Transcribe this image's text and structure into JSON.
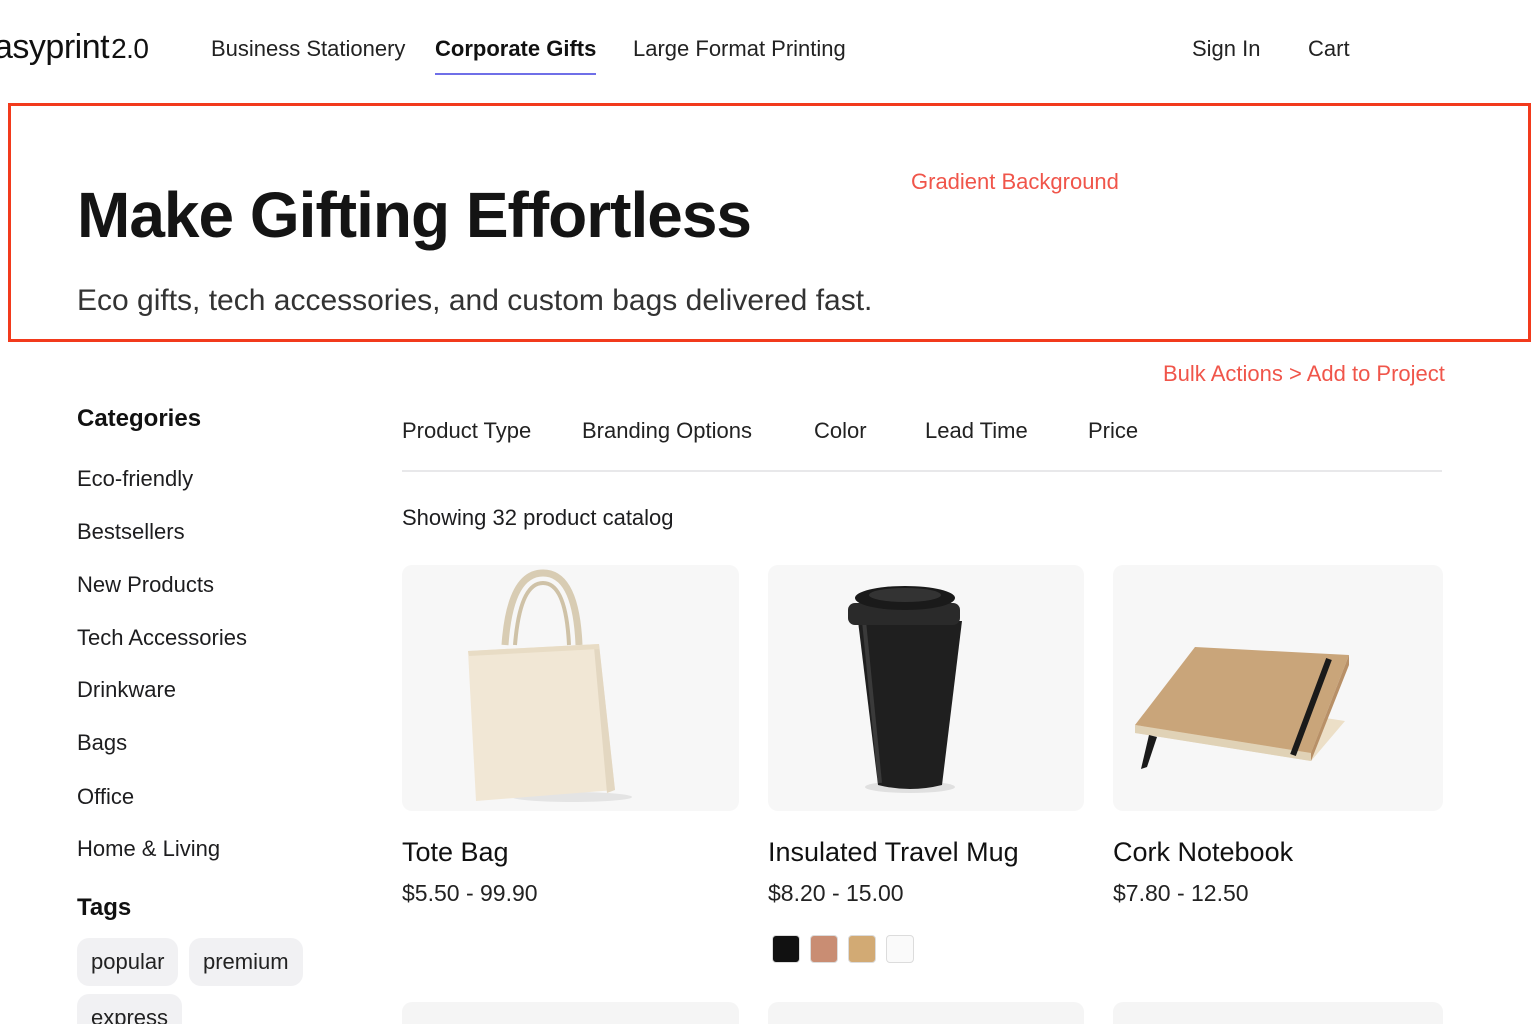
{
  "nav": {
    "logo_text": "asyprint",
    "logo_version": "2.0",
    "links": [
      "Business Stationery",
      "Corporate Gifts",
      "Large Format Printing"
    ],
    "active_link": "Corporate Gifts",
    "sign_in": "Sign In",
    "cart": "Cart"
  },
  "hero": {
    "title": "Make Gifting Effortless",
    "subtitle": "Eco gifts, tech accessories, and custom bags delivered fast.",
    "annotation": "Gradient Background"
  },
  "annotation_bulk": "Bulk Actions > Add to Project",
  "sidebar": {
    "categories_heading": "Categories",
    "categories": [
      "Eco-friendly",
      "Bestsellers",
      "New Products",
      "Tech Accessories",
      "Drinkware",
      "Bags",
      "Office",
      "Home & Living"
    ],
    "tags_heading": "Tags",
    "tags": [
      "popular",
      "premium",
      "express"
    ]
  },
  "filters": [
    "Product Type",
    "Branding Options",
    "Color",
    "Lead Time",
    "Price"
  ],
  "results_count": "Showing 32 product catalog",
  "products": [
    {
      "name": "Tote Bag",
      "price": "$5.50 - 99.90",
      "image_icon": "tote-bag-image"
    },
    {
      "name": "Insulated Travel Mug",
      "price": "$8.20 - 15.00",
      "image_icon": "travel-mug-image",
      "swatches": [
        "#111111",
        "#c98d73",
        "#d2aa74",
        "#fafafa"
      ]
    },
    {
      "name": "Cork Notebook",
      "price": "$7.80 - 12.50",
      "image_icon": "cork-notebook-image"
    }
  ],
  "colors": {
    "annotation": "#f0554a",
    "hero_border": "#f23a1c",
    "active_underline": "#6f6fe8"
  }
}
